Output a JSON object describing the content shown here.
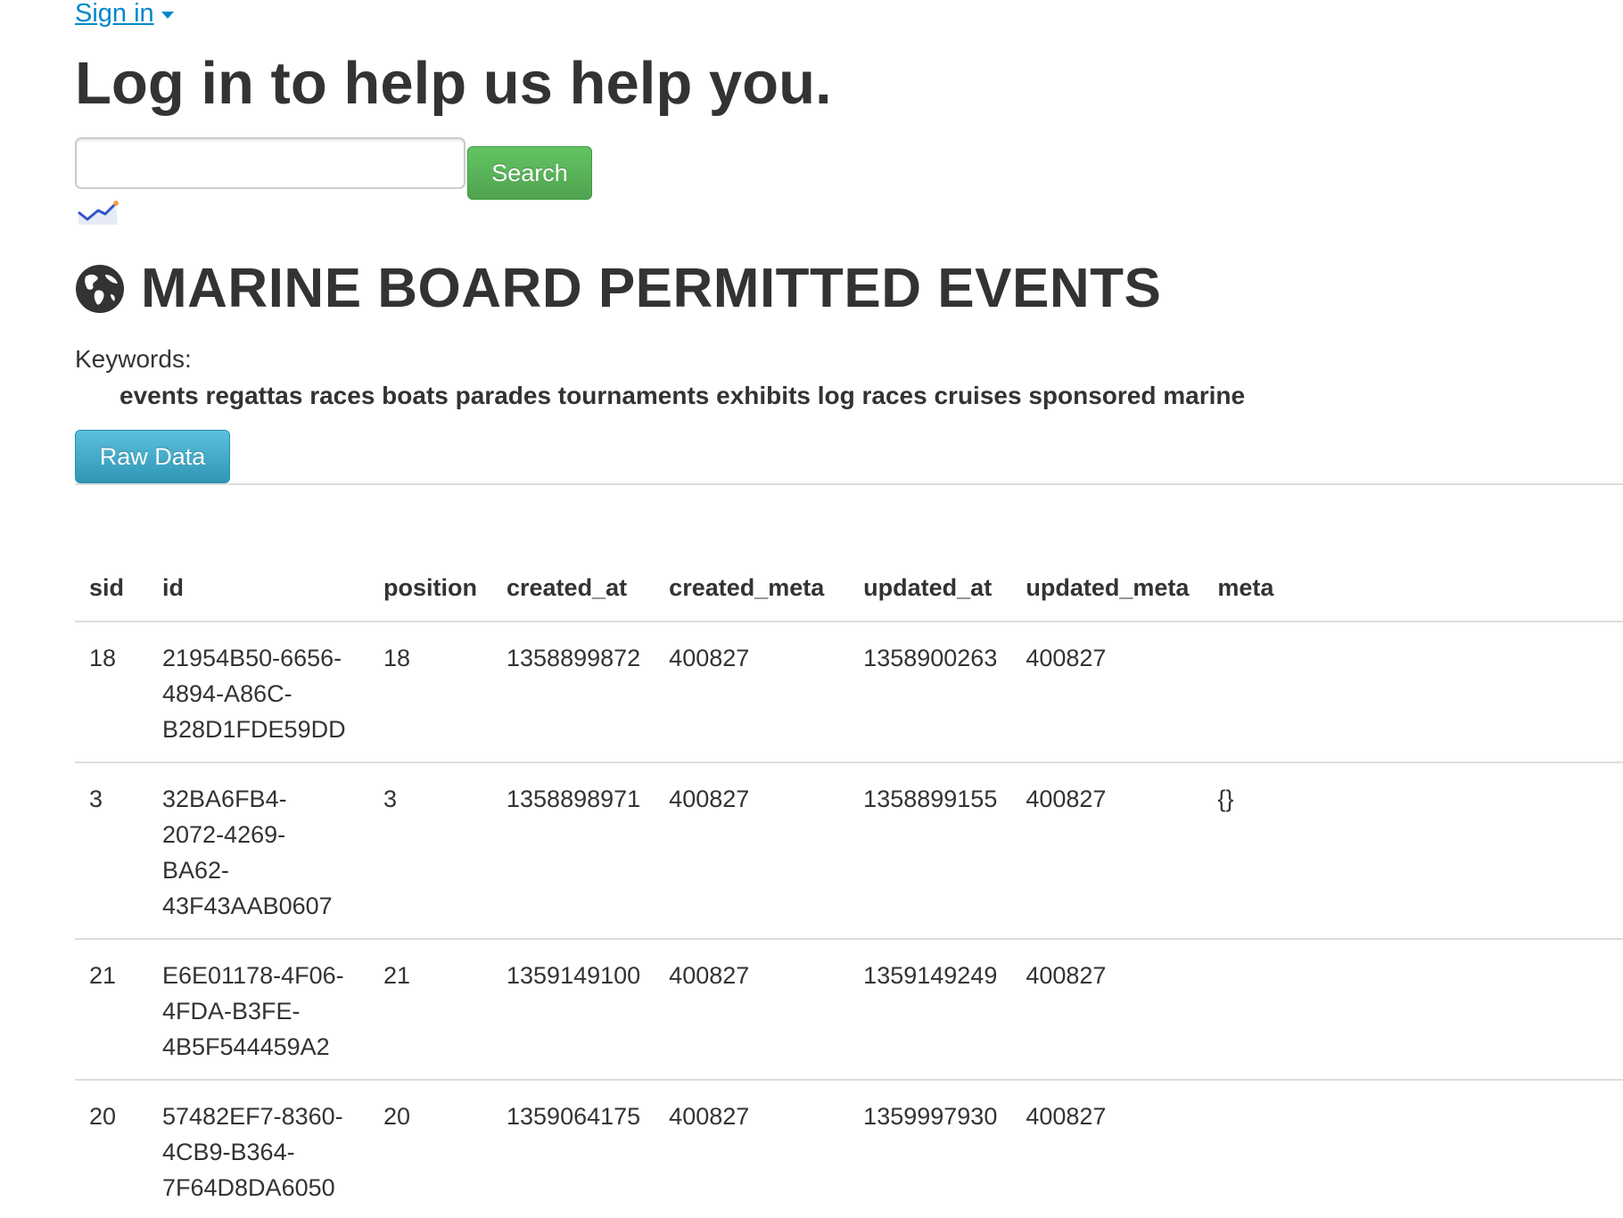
{
  "header": {
    "signin_label": "Sign in",
    "login_prompt": "Log in to help us help you."
  },
  "search": {
    "value": "",
    "placeholder": "",
    "button_label": "Search"
  },
  "dataset": {
    "title": "MARINE BOARD PERMITTED EVENTS",
    "keywords_label": "Keywords:",
    "keywords": "events regattas races boats parades tournaments exhibits log races cruises sponsored marine",
    "raw_data_label": "Raw Data"
  },
  "table": {
    "columns": [
      "sid",
      "id",
      "position",
      "created_at",
      "created_meta",
      "updated_at",
      "updated_meta",
      "meta"
    ],
    "rows": [
      {
        "sid": "18",
        "id_lines": [
          "21954B50-6656-",
          "4894-A86C-",
          "B28D1FDE59DD"
        ],
        "position": "18",
        "created_at": "1358899872",
        "created_meta": "400827",
        "updated_at": "1358900263",
        "updated_meta": "400827",
        "meta": ""
      },
      {
        "sid": "3",
        "id_lines": [
          "32BA6FB4-",
          "2072-4269-",
          "BA62-",
          "43F43AAB0607"
        ],
        "position": "3",
        "created_at": "1358898971",
        "created_meta": "400827",
        "updated_at": "1358899155",
        "updated_meta": "400827",
        "meta": "{}"
      },
      {
        "sid": "21",
        "id_lines": [
          "E6E01178-4F06-",
          "4FDA-B3FE-",
          "4B5F544459A2"
        ],
        "position": "21",
        "created_at": "1359149100",
        "created_meta": "400827",
        "updated_at": "1359149249",
        "updated_meta": "400827",
        "meta": ""
      },
      {
        "sid": "20",
        "id_lines": [
          "57482EF7-8360-",
          "4CB9-B364-",
          "7F64D8DA6050"
        ],
        "position": "20",
        "created_at": "1359064175",
        "created_meta": "400827",
        "updated_at": "1359997930",
        "updated_meta": "400827",
        "meta": ""
      }
    ]
  },
  "colors": {
    "link": "#0088cc",
    "search_button": "#51a351",
    "raw_button": "#2f96b4"
  },
  "icons": {
    "trend": "trend-chart-icon",
    "globe": "globe-icon",
    "caret": "caret-down-icon"
  }
}
